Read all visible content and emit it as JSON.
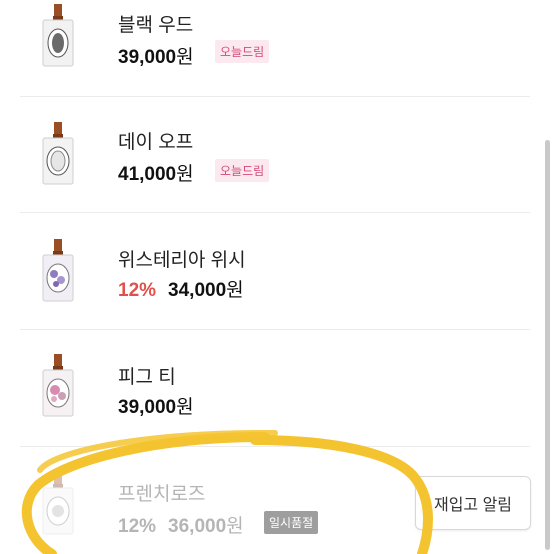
{
  "products": [
    {
      "name": "블랙 우드",
      "discount": "",
      "price": "39,000",
      "currency": "원",
      "badge": "오늘드림",
      "badge_style": "pink",
      "status": "available",
      "label_color": "#6a6a6a",
      "flower_color": ""
    },
    {
      "name": "데이 오프",
      "discount": "",
      "price": "41,000",
      "currency": "원",
      "badge": "오늘드림",
      "badge_style": "pink",
      "status": "available",
      "label_color": "#8a8a8a",
      "flower_color": ""
    },
    {
      "name": "위스테리아 위시",
      "discount": "12%",
      "price": "34,000",
      "currency": "원",
      "badge": "",
      "badge_style": "",
      "status": "available",
      "label_color": "#9b8bb8",
      "flower_color": "#8f7bc0"
    },
    {
      "name": "피그 티",
      "discount": "",
      "price": "39,000",
      "currency": "원",
      "badge": "",
      "badge_style": "",
      "status": "available",
      "label_color": "#c9a0b5",
      "flower_color": "#d68bb0"
    },
    {
      "name": "프렌치로즈",
      "discount": "12%",
      "price": "36,000",
      "currency": "원",
      "badge": "일시품절",
      "badge_style": "gray",
      "status": "soldout",
      "label_color": "#b0b0b0",
      "flower_color": ""
    }
  ],
  "restock_button": {
    "label": "재입고 알림"
  },
  "colors": {
    "discount": "#e0504c",
    "highlight": "#f4c430",
    "badge_pink_bg": "#fbe9ef",
    "badge_pink_text": "#d44a77"
  }
}
